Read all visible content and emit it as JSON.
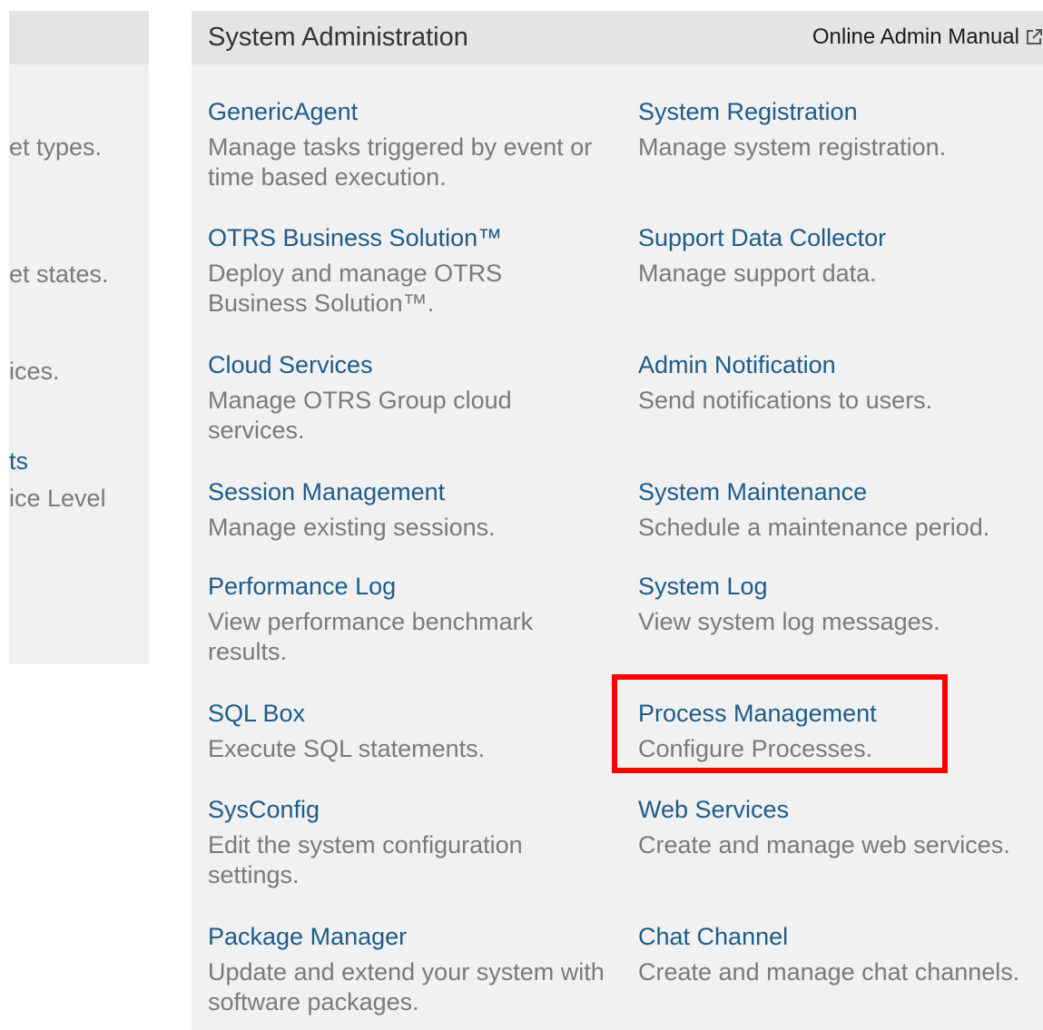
{
  "left_panel": {
    "fragments": [
      "et types.",
      "et states.",
      "ices.",
      "ts",
      "ice Level"
    ]
  },
  "header": {
    "title": "System Administration",
    "manual_link": "Online Admin Manual",
    "manual_icon": "external-link-icon"
  },
  "items": [
    {
      "name": "GenericAgent",
      "desc": "Manage tasks triggered by event or time based execution."
    },
    {
      "name": "System Registration",
      "desc": "Manage system registration."
    },
    {
      "name": "OTRS Business Solution™",
      "desc": "Deploy and manage OTRS Business Solution™."
    },
    {
      "name": "Support Data Collector",
      "desc": "Manage support data."
    },
    {
      "name": "Cloud Services",
      "desc": "Manage OTRS Group cloud services."
    },
    {
      "name": "Admin Notification",
      "desc": "Send notifications to users."
    },
    {
      "name": "Session Management",
      "desc": "Manage existing sessions."
    },
    {
      "name": "System Maintenance",
      "desc": "Schedule a maintenance period."
    },
    {
      "name": "Performance Log",
      "desc": "View performance benchmark results."
    },
    {
      "name": "System Log",
      "desc": "View system log messages."
    },
    {
      "name": "SQL Box",
      "desc": "Execute SQL statements."
    },
    {
      "name": "Process Management",
      "desc": "Configure Processes."
    },
    {
      "name": "SysConfig",
      "desc": "Edit the system configuration settings."
    },
    {
      "name": "Web Services",
      "desc": "Create and manage web services."
    },
    {
      "name": "Package Manager",
      "desc": "Update and extend your system with software packages."
    },
    {
      "name": "Chat Channel",
      "desc": "Create and manage chat channels."
    }
  ],
  "highlight": {
    "color": "#ff0000"
  }
}
